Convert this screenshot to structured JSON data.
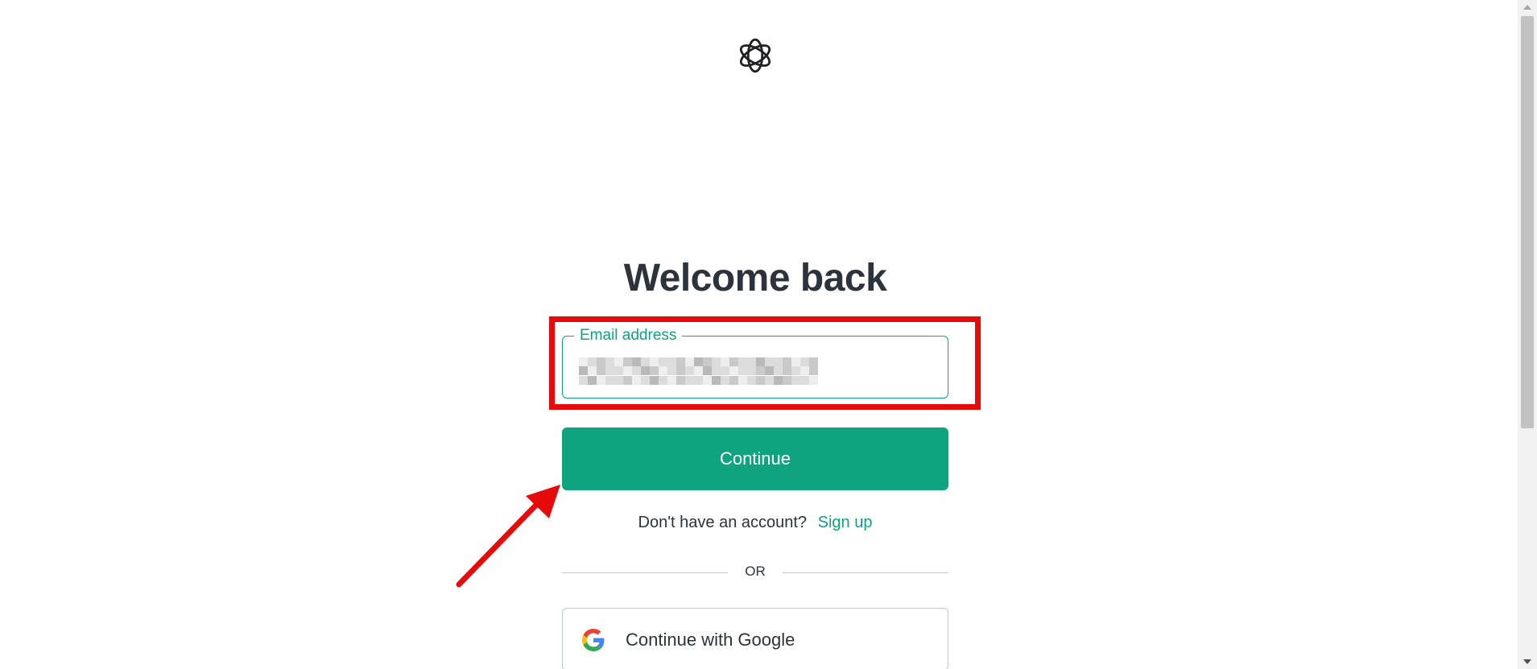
{
  "header": {
    "logo_icon": "openai-logo-icon"
  },
  "main": {
    "title": "Welcome back",
    "email": {
      "label": "Email address",
      "value": ""
    },
    "continue_label": "Continue",
    "signup_question": "Don't have an account?",
    "signup_link": "Sign up",
    "divider_text": "OR",
    "google_label": "Continue with Google"
  },
  "colors": {
    "accent": "#10a37f",
    "annotation": "#e50b0b",
    "text": "#2d333a"
  }
}
